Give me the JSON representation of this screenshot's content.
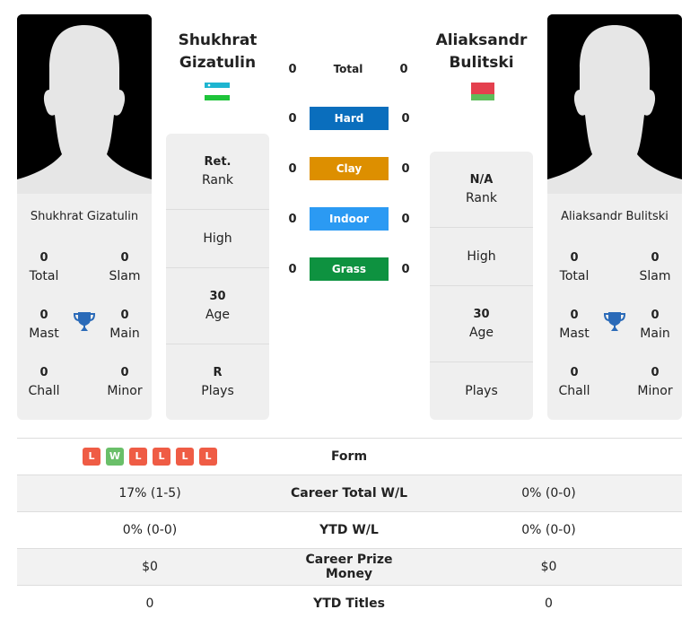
{
  "players": {
    "left": {
      "name_line1": "Shukhrat",
      "name_line2": "Gizatulin",
      "full_name": "Shukhrat Gizatulin",
      "flag": "uzbekistan-flag",
      "stats": {
        "total": "0",
        "total_label": "Total",
        "slam": "0",
        "slam_label": "Slam",
        "mast": "0",
        "mast_label": "Mast",
        "main": "0",
        "main_label": "Main",
        "chall": "0",
        "chall_label": "Chall",
        "minor": "0",
        "minor_label": "Minor"
      },
      "info": {
        "rank_value": "Ret.",
        "rank_label": "Rank",
        "high_value": "",
        "high_label": "High",
        "age_value": "30",
        "age_label": "Age",
        "plays_value": "R",
        "plays_label": "Plays"
      }
    },
    "right": {
      "name_line1": "Aliaksandr",
      "name_line2": "Bulitski",
      "full_name": "Aliaksandr Bulitski",
      "flag": "belarus-flag",
      "stats": {
        "total": "0",
        "total_label": "Total",
        "slam": "0",
        "slam_label": "Slam",
        "mast": "0",
        "mast_label": "Mast",
        "main": "0",
        "main_label": "Main",
        "chall": "0",
        "chall_label": "Chall",
        "minor": "0",
        "minor_label": "Minor"
      },
      "info": {
        "rank_value": "N/A",
        "rank_label": "Rank",
        "high_value": "",
        "high_label": "High",
        "age_value": "30",
        "age_label": "Age",
        "plays_value": "",
        "plays_label": "Plays"
      }
    }
  },
  "h2h": {
    "total": {
      "label": "Total",
      "left": "0",
      "right": "0"
    },
    "surfaces": [
      {
        "label": "Hard",
        "left": "0",
        "right": "0",
        "color": "#0a6ebd"
      },
      {
        "label": "Clay",
        "left": "0",
        "right": "0",
        "color": "#dd8f00"
      },
      {
        "label": "Indoor",
        "left": "0",
        "right": "0",
        "color": "#2b9af3"
      },
      {
        "label": "Grass",
        "left": "0",
        "right": "0",
        "color": "#0e9240"
      }
    ]
  },
  "comparison": {
    "form": {
      "label": "Form",
      "left": [
        "L",
        "W",
        "L",
        "L",
        "L",
        "L"
      ],
      "colors": {
        "W": "#6abf69",
        "L": "#ef5c45"
      }
    },
    "rows": [
      {
        "label": "Career Total W/L",
        "left": "17% (1-5)",
        "right": "0% (0-0)"
      },
      {
        "label": "YTD W/L",
        "left": "0% (0-0)",
        "right": "0% (0-0)"
      },
      {
        "label": "Career Prize Money",
        "left": "$0",
        "right": "$0"
      },
      {
        "label": "YTD Titles",
        "left": "0",
        "right": "0"
      }
    ]
  }
}
